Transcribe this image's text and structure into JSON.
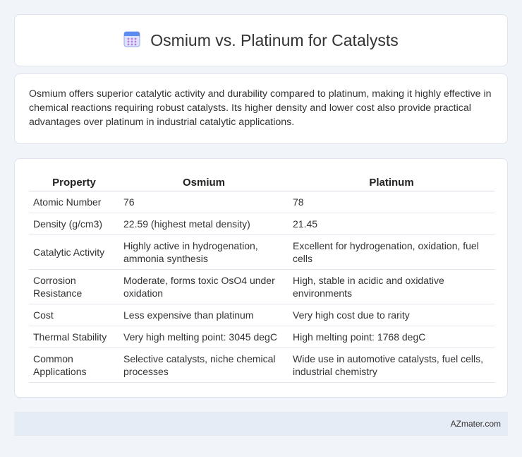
{
  "header": {
    "title": "Osmium vs. Platinum for Catalysts",
    "icon": "calendar-grid-icon"
  },
  "intro": {
    "text": "Osmium offers superior catalytic activity and durability compared to platinum, making it highly effective in chemical reactions requiring robust catalysts. Its higher density and lower cost also provide practical advantages over platinum in industrial catalytic applications."
  },
  "table": {
    "headers": [
      "Property",
      "Osmium",
      "Platinum"
    ],
    "rows": [
      [
        "Atomic Number",
        "76",
        "78"
      ],
      [
        "Density (g/cm3)",
        "22.59 (highest metal density)",
        "21.45"
      ],
      [
        "Catalytic Activity",
        "Highly active in hydrogenation, ammonia synthesis",
        "Excellent for hydrogenation, oxidation, fuel cells"
      ],
      [
        "Corrosion Resistance",
        "Moderate, forms toxic OsO4 under oxidation",
        "High, stable in acidic and oxidative environments"
      ],
      [
        "Cost",
        "Less expensive than platinum",
        "Very high cost due to rarity"
      ],
      [
        "Thermal Stability",
        "Very high melting point: 3045 degC",
        "High melting point: 1768 degC"
      ],
      [
        "Common Applications",
        "Selective catalysts, niche chemical processes",
        "Wide use in automotive catalysts, fuel cells, industrial chemistry"
      ]
    ]
  },
  "footer": {
    "text": "AZmater.com"
  }
}
